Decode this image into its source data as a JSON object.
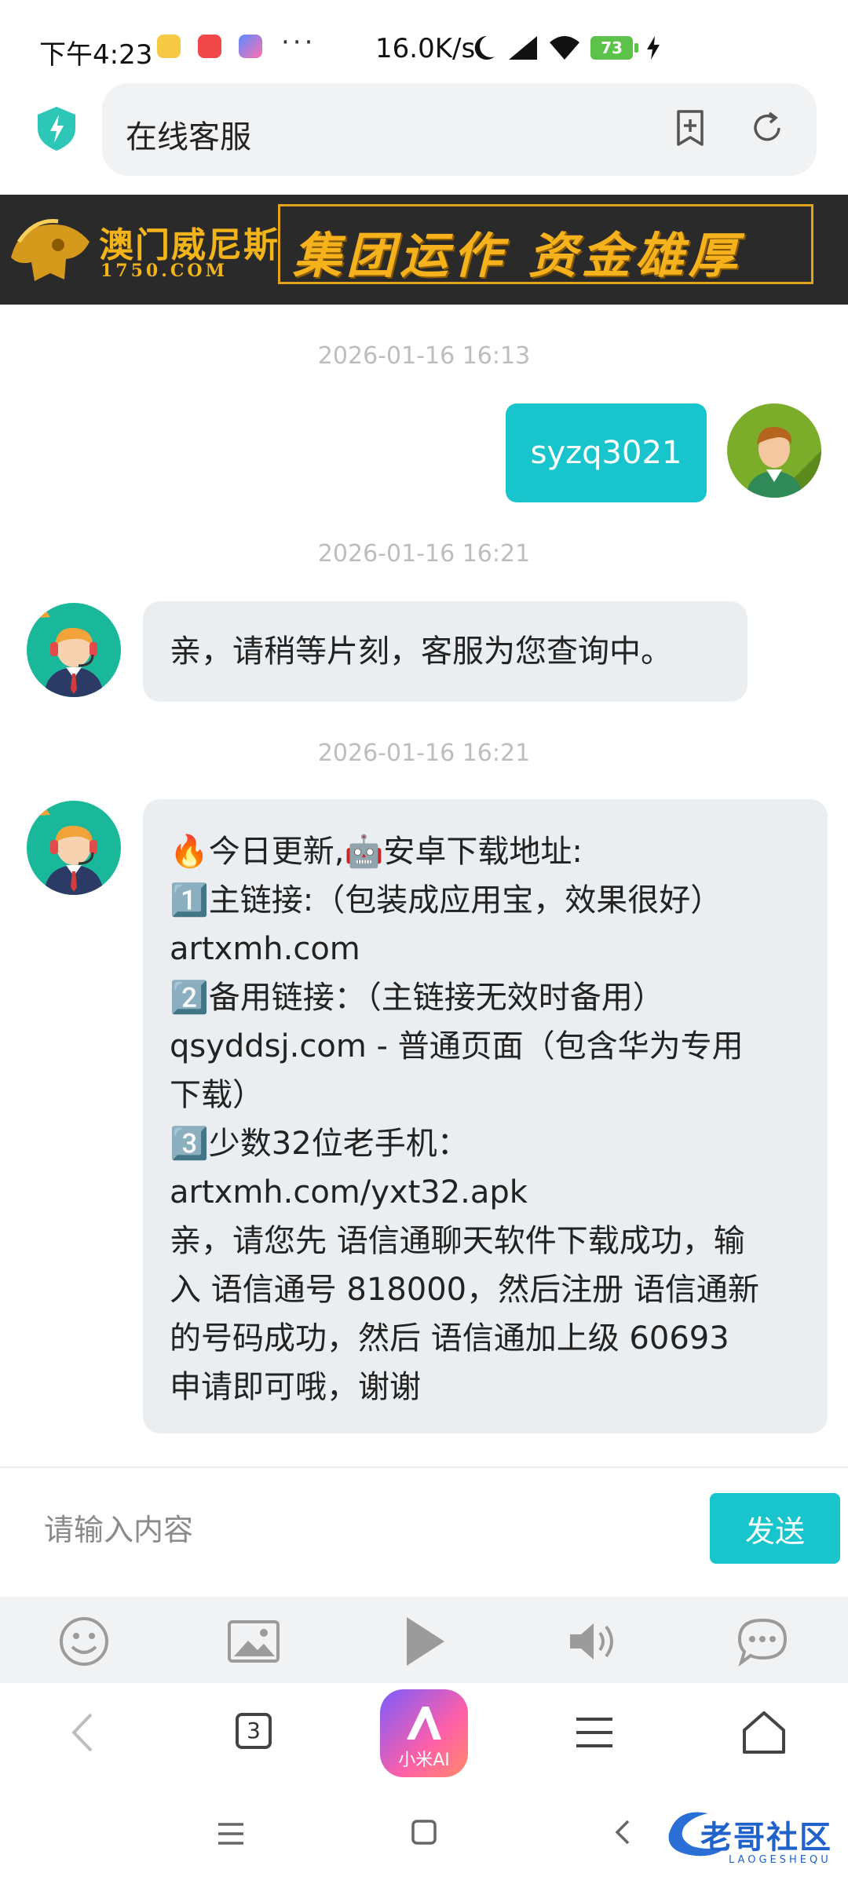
{
  "status_bar": {
    "time": "下午4:23",
    "dots": "···",
    "net_speed": "16.0K/s",
    "battery": "73"
  },
  "url_bar": {
    "title": "在线客服"
  },
  "banner": {
    "brand": "澳门威尼斯",
    "brand_url": "1750.COM",
    "slogan": "集团运作 资金雄厚"
  },
  "chat": {
    "messages": [
      {
        "timestamp": "2026-01-16 16:13",
        "side": "right",
        "text": "syzq3021"
      },
      {
        "timestamp": "2026-01-16 16:21",
        "side": "left",
        "text": "亲，请稍等片刻，客服为您查询中。"
      },
      {
        "timestamp": "2026-01-16 16:21",
        "side": "left",
        "lines": [
          "🔥今日更新,🤖安卓下载地址:",
          "1️⃣主链接:（包装成应用宝，效果很好）",
          "artxmh.com",
          "2️⃣备用链接：（主链接无效时备用）",
          "qsyddsj.com - 普通页面（包含华为专用",
          "下载）",
          "3️⃣少数32位老手机：",
          "artxmh.com/yxt32.apk",
          "亲，请您先 语信通聊天软件下载成功，输",
          "入 语信通号 818000，然后注册 语信通新",
          "的号码成功，然后 语信通加上级 60693",
          "申请即可哦，谢谢"
        ]
      }
    ]
  },
  "input": {
    "placeholder": "请输入内容",
    "send_label": "发送"
  },
  "toolbar": {
    "tools": [
      "emoji-icon",
      "image-icon",
      "play-icon",
      "volume-icon",
      "chat-bubble-icon"
    ]
  },
  "browser_nav": {
    "tab_count": "3",
    "ai_label": "小米AI"
  },
  "watermark": {
    "text": "老哥社区",
    "sub": "LAOGESHEQU"
  },
  "colors": {
    "accent": "#19c5cd",
    "bubble_left": "#ebeef0",
    "banner_gold": "#f3b41a"
  }
}
